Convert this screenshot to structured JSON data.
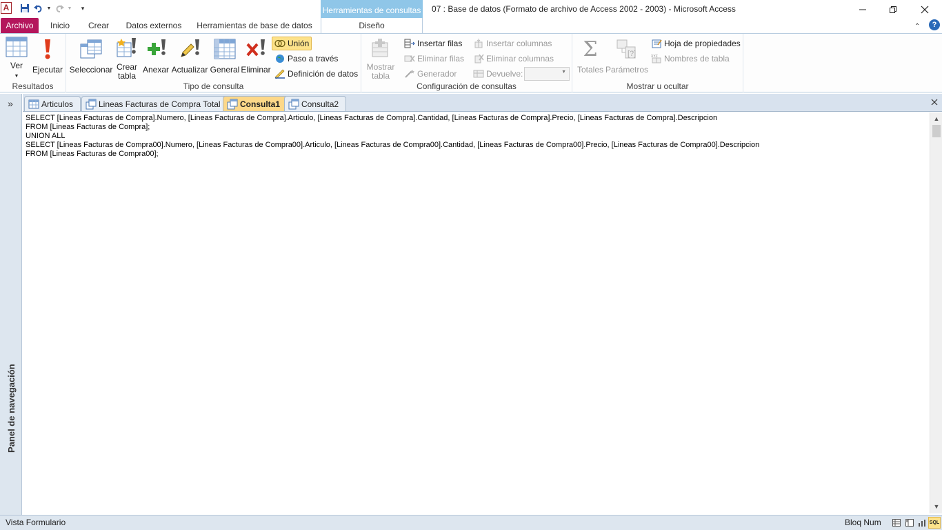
{
  "window": {
    "title": "07 : Base de datos (Formato de archivo de Access 2002 - 2003)  -  Microsoft Access",
    "context_tab_header": "Herramientas de consultas",
    "app_logo": "A"
  },
  "tabs": {
    "archivo": "Archivo",
    "inicio": "Inicio",
    "crear": "Crear",
    "datos_externos": "Datos externos",
    "herramientas_bd": "Herramientas de base de datos",
    "diseno": "Diseño"
  },
  "ribbon": {
    "resultados": {
      "label": "Resultados",
      "ver": "Ver",
      "ejecutar": "Ejecutar"
    },
    "tipo_consulta": {
      "label": "Tipo de consulta",
      "seleccionar": "Seleccionar",
      "crear_tabla_1": "Crear",
      "crear_tabla_2": "tabla",
      "anexar": "Anexar",
      "actualizar": "Actualizar",
      "general": "General",
      "eliminar": "Eliminar",
      "union": "Unión",
      "paso_a_traves": "Paso a través",
      "definicion_datos": "Definición de datos"
    },
    "configuracion": {
      "label": "Configuración de consultas",
      "mostrar_tabla_1": "Mostrar",
      "mostrar_tabla_2": "tabla",
      "insertar_filas": "Insertar filas",
      "eliminar_filas": "Eliminar filas",
      "generador": "Generador",
      "insertar_columnas": "Insertar columnas",
      "eliminar_columnas": "Eliminar columnas",
      "devuelve": "Devuelve:"
    },
    "mostrar_ocultar": {
      "label": "Mostrar u ocultar",
      "totales": "Totales",
      "parametros": "Parámetros",
      "hoja_propiedades": "Hoja de propiedades",
      "nombres_tabla": "Nombres de tabla"
    }
  },
  "nav_pane": {
    "label": "Panel de navegación",
    "expand": "»"
  },
  "document_tabs": [
    {
      "label": "Articulos",
      "active": false
    },
    {
      "label": "Lineas Facturas de Compra Total",
      "active": false
    },
    {
      "label": "Consulta1",
      "active": true
    },
    {
      "label": "Consulta2",
      "active": false
    }
  ],
  "sql": {
    "lines": [
      "SELECT [Lineas Facturas de Compra].Numero, [Lineas Facturas de Compra].Articulo, [Lineas Facturas de Compra].Cantidad, [Lineas Facturas de Compra].Precio, [Lineas Facturas de Compra].Descripcion",
      "FROM [Lineas Facturas de Compra];",
      "UNION ALL",
      "SELECT [Lineas Facturas de Compra00].Numero, [Lineas Facturas de Compra00].Articulo, [Lineas Facturas de Compra00].Cantidad, [Lineas Facturas de Compra00].Precio, [Lineas Facturas de Compra00].Descripcion",
      "FROM [Lineas Facturas de Compra00];"
    ]
  },
  "status": {
    "left": "Vista Formulario",
    "right": "Bloq Num",
    "sql_view": "SQL"
  },
  "colors": {
    "archivo_tab": "#b4165c",
    "context_header": "#8fc6e8",
    "active_tab": "#fdd889"
  }
}
